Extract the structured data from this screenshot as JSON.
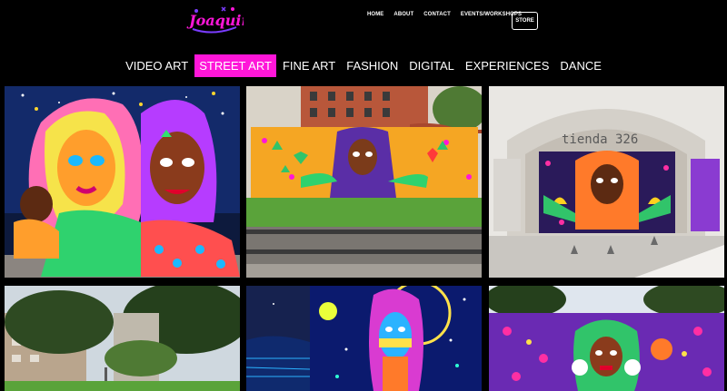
{
  "brand": {
    "logo_text": "Joaquina",
    "accent": "#ff16d9"
  },
  "top_nav": {
    "items": [
      "HOME",
      "ABOUT",
      "CONTACT",
      "EVENTS/WORKSHOPS"
    ],
    "store_label": "STORE"
  },
  "categories": {
    "items": [
      "VIDEO ART",
      "STREET ART",
      "FINE ART",
      "FASHION",
      "DIGITAL",
      "EXPERIENCES",
      "DANCE"
    ],
    "active": "STREET ART"
  },
  "gallery": {
    "tiles": [
      {
        "name": "mural-two-women",
        "caption": ""
      },
      {
        "name": "mural-wall-goddess",
        "caption": ""
      },
      {
        "name": "mural-tienda-326",
        "sign_text": "tienda 326"
      },
      {
        "name": "mural-trees-building",
        "caption": ""
      },
      {
        "name": "mural-night-face",
        "caption": ""
      },
      {
        "name": "mural-purple-wall",
        "caption": ""
      }
    ]
  }
}
